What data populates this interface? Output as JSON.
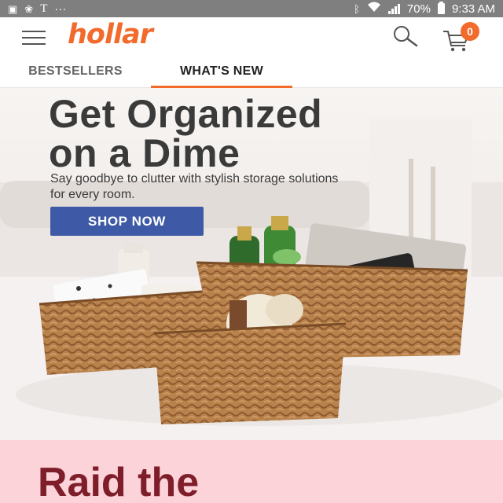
{
  "status_bar": {
    "carrier": "T",
    "dots": "···",
    "battery": "70%",
    "time": "9:33 AM"
  },
  "header": {
    "logo": "hollar",
    "cart_count": "0"
  },
  "tabs": [
    {
      "label": "BESTSELLERS",
      "selected": false
    },
    {
      "label": "WHAT'S NEW",
      "selected": true
    }
  ],
  "hero": {
    "title_line1": "Get Organized",
    "title_line2": "on a Dime",
    "subtitle": "Say goodbye to clutter with stylish storage solutions for every room.",
    "cta_label": "SHOP NOW"
  },
  "promo": {
    "title": "Raid the"
  },
  "colors": {
    "brand": "#f26a2c",
    "cta": "#3e5aa6",
    "promo_bg": "#fcd3d8",
    "promo_text": "#7e1e2b"
  },
  "icons": [
    "image-icon",
    "pinwheel-icon",
    "bluetooth-icon",
    "wifi-icon",
    "signal-icon",
    "battery-icon",
    "menu-icon",
    "search-icon",
    "cart-icon"
  ]
}
